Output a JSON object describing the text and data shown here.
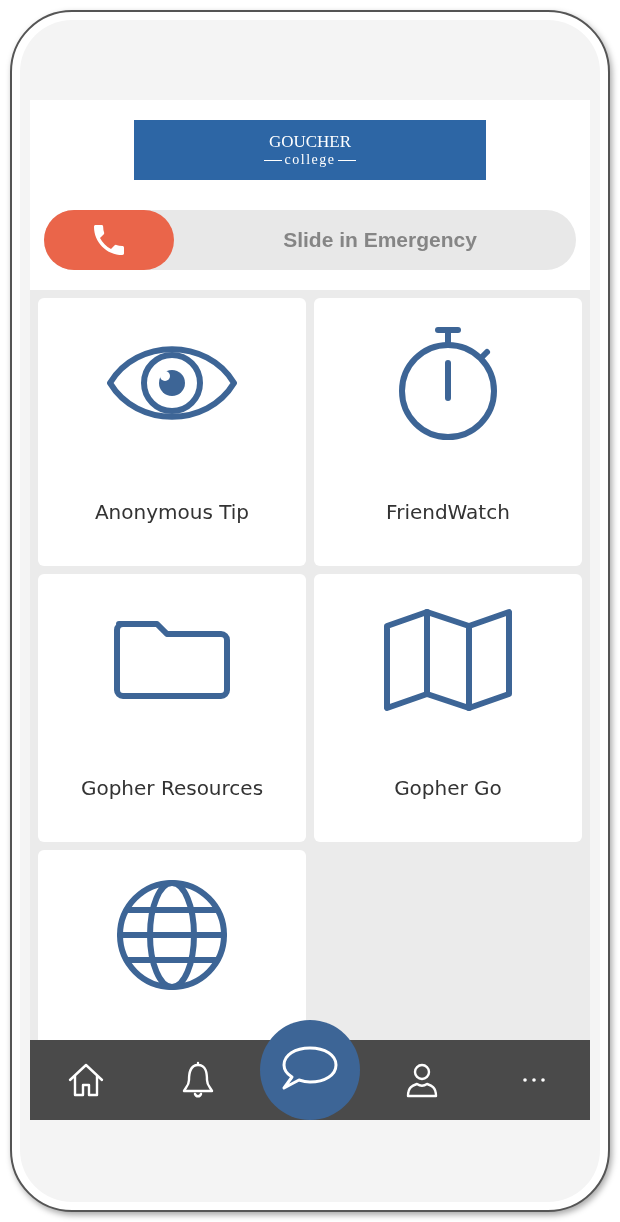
{
  "logo": {
    "name": "GOUCHER",
    "subtitle": "college"
  },
  "emergency_slider": {
    "label": "Slide in Emergency",
    "level": 0
  },
  "tiles": [
    {
      "kind": "eye",
      "label": "Anonymous Tip"
    },
    {
      "kind": "stopwatch",
      "label": "FriendWatch"
    },
    {
      "kind": "folder",
      "label": "Gopher Resources"
    },
    {
      "kind": "map",
      "label": "Gopher Go"
    },
    {
      "kind": "globe"
    }
  ],
  "nav": [
    {
      "kind": "home"
    },
    {
      "kind": "bell"
    },
    {
      "kind": "chat"
    },
    {
      "kind": "person"
    },
    {
      "kind": "more"
    }
  ]
}
